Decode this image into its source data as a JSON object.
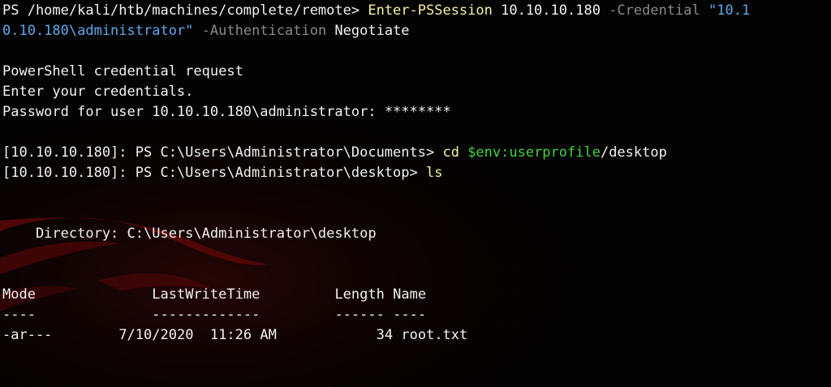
{
  "terminal": {
    "line1": {
      "prompt": "PS /home/kali/htb/machines/complete/remote> ",
      "command": "Enter-PSSession",
      "arg_host": " 10.10.10.180 ",
      "param_credential": "-Credential",
      "space1": " ",
      "string_part1": "\"10.1",
      "string_part2": "0.10.180\\administrator\"",
      "space2": " ",
      "param_auth": "-Authentication",
      "auth_value": " Negotiate"
    },
    "credential_prompt": {
      "title": "PowerShell credential request",
      "instruction": "Enter your credentials.",
      "password_label": "Password for user 10.10.10.180\\administrator: ",
      "password_mask": "********"
    },
    "line_cd": {
      "prompt": "[10.10.10.180]: PS C:\\Users\\Administrator\\Documents> ",
      "command": "cd",
      "space": " ",
      "variable": "$env:userprofile",
      "path_rest": "/desktop"
    },
    "line_ls": {
      "prompt": "[10.10.10.180]: PS C:\\Users\\Administrator\\desktop> ",
      "command": "ls"
    },
    "directory_header": "    Directory: C:\\Users\\Administrator\\desktop",
    "listing": {
      "columns": [
        "Mode",
        "LastWriteTime",
        "Length",
        "Name"
      ],
      "underline": [
        "----",
        "-------------",
        "------",
        "----"
      ],
      "rows": [
        {
          "mode": "-ar---",
          "date": "7/10/2020",
          "time": "11:26 AM",
          "length": "34",
          "name": "root.txt"
        }
      ]
    }
  },
  "colors": {
    "background": "#030303",
    "text": "#f2f2f2",
    "command": "#f7f1a3",
    "parameter": "#8a8a8a",
    "string": "#5fa8e8",
    "variable": "#3fd43f",
    "background_mark": "#6e0a0a"
  },
  "icons": {
    "background_mark": "kali-dragon-icon"
  }
}
